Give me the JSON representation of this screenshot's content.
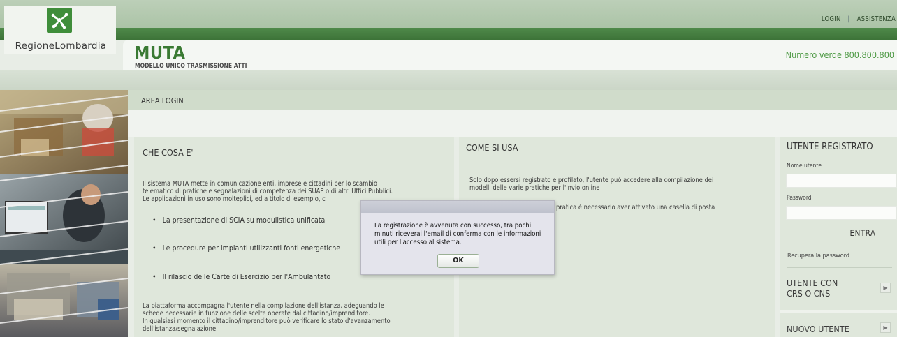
{
  "topbar": {
    "login_label": "LOGIN",
    "separator": "|",
    "assistenza_label": "ASSISTENZA"
  },
  "logo": {
    "text": "RegioneLombardia",
    "icon": "lombardy-rose-icon"
  },
  "header": {
    "title": "MUTA",
    "subtitle": "MODELLO UNICO TRASMISSIONE ATTI",
    "numero_verde": "Numero verde 800.800.800"
  },
  "section_title": "AREA LOGIN",
  "che_cosa": {
    "title": "CHE COSA E'",
    "intro_lines": [
      "Il sistema MUTA mette in comunicazione enti, imprese e cittadini per lo scambio",
      "telematico di pratiche e segnalazioni di competenza dei SUAP o di altri Uffici Pubblici.",
      "Le applicazioni in uso sono molteplici, ed a titolo di esempio, c"
    ],
    "bullets": [
      "La presentazione di SCIA su modulistica unificata",
      "Le procedure per impianti utilizzanti fonti energetiche",
      "Il rilascio delle Carte di Esercizio per l'Ambulantato"
    ],
    "outro_lines": [
      "La piattaforma accompagna l'utente nella compilazione dell'istanza, adeguando le",
      "schede necessarie in funzione delle scelte operate dal cittadino/imprenditore.",
      "In qualsiasi momento il cittadino/imprenditore può verificare lo stato d'avanzamento",
      "dell'istanza/segnalazione."
    ]
  },
  "come_si_usa": {
    "title": "COME SI USA",
    "lines": [
      "Solo dopo essersi registrato e profilato, l'utente può accedere alla compilazione dei",
      "modelli delle varie pratiche per l'invio online"
    ],
    "partial_line": "pratica è necessario aver attivato una casella di posta"
  },
  "login_panel": {
    "title": "UTENTE REGISTRATO",
    "username_label": "Nome utente",
    "username_value": "",
    "password_label": "Password",
    "password_value": "",
    "submit_label": "ENTRA",
    "recover_label": "Recupera la password",
    "crs_line1": "UTENTE CON",
    "crs_line2": "CRS O CNS",
    "new_user_label": "NUOVO UTENTE",
    "arrow_glyph": "▶"
  },
  "dialog": {
    "message": "La registrazione è avvenuta con successo, tra pochi minuti riceverai l'email di conferma con le informazioni utili per l'accesso al sistema.",
    "ok_label": "OK"
  },
  "colors": {
    "brand_green": "#3a7a33",
    "numero_green": "#4e9a45",
    "panel_bg": "#dfe7db"
  }
}
